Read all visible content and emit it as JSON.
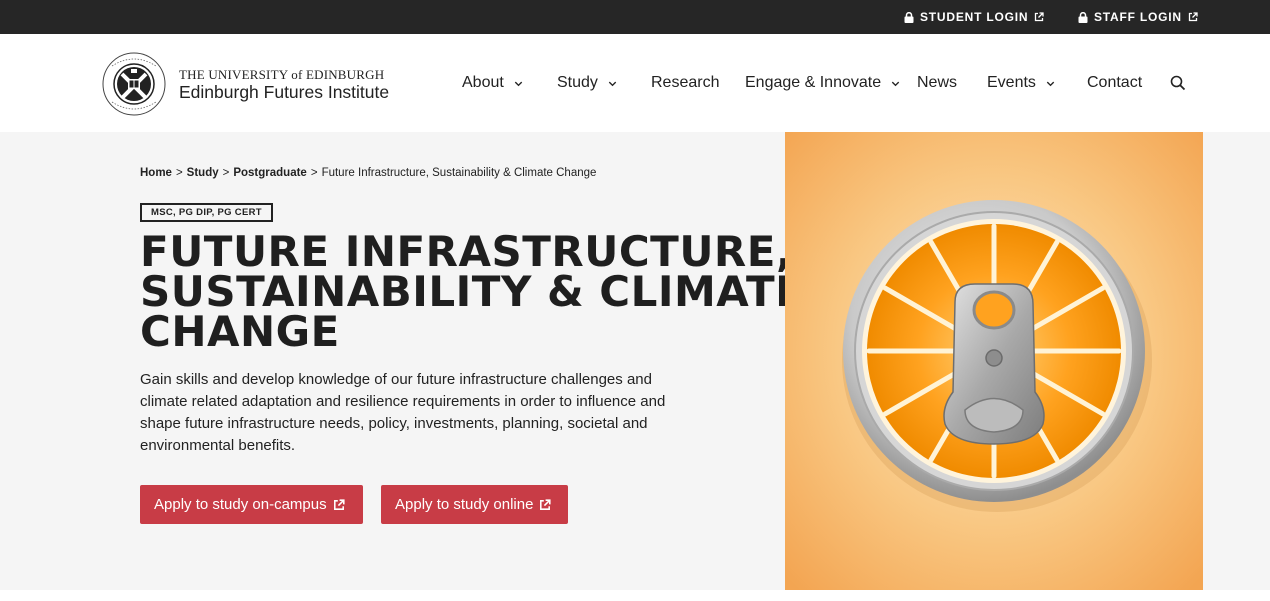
{
  "topbar": {
    "student_login": "STUDENT LOGIN",
    "staff_login": "STAFF LOGIN"
  },
  "header": {
    "logo_university": "THE UNIVERSITY of EDINBURGH",
    "logo_institute": "Edinburgh Futures Institute",
    "nav": [
      {
        "label": "About",
        "has_dropdown": true
      },
      {
        "label": "Study",
        "has_dropdown": true
      },
      {
        "label": "Research",
        "has_dropdown": false
      },
      {
        "label": "Engage & Innovate",
        "has_dropdown": true
      },
      {
        "label": "News",
        "has_dropdown": false
      },
      {
        "label": "Events",
        "has_dropdown": true
      },
      {
        "label": "Contact",
        "has_dropdown": false
      }
    ],
    "search_icon": "search-icon"
  },
  "breadcrumb": {
    "home": "Home",
    "study": "Study",
    "postgraduate": "Postgraduate",
    "sep": ">",
    "current": "Future Infrastructure, Sustainability & Climate Change"
  },
  "hero": {
    "badge": "MSC, PG DIP, PG CERT",
    "title_lines": [
      "FUTURE INFRASTRUCTURE,",
      "SUSTAINABILITY & CLIMATE",
      "CHANGE"
    ],
    "description": "Gain skills and develop knowledge of our future infrastructure challenges and climate related adaptation and resilience requirements in order to influence and shape future infrastructure needs, policy, investments, planning, societal and environmental benefits.",
    "buttons": {
      "campus": "Apply to study on-campus",
      "online": "Apply to study online"
    }
  },
  "colors": {
    "topbar_bg": "#262626",
    "accent_button": "#c83c46",
    "hero_bg": "#f5f5f5",
    "image_bg": "#f7b45a"
  }
}
